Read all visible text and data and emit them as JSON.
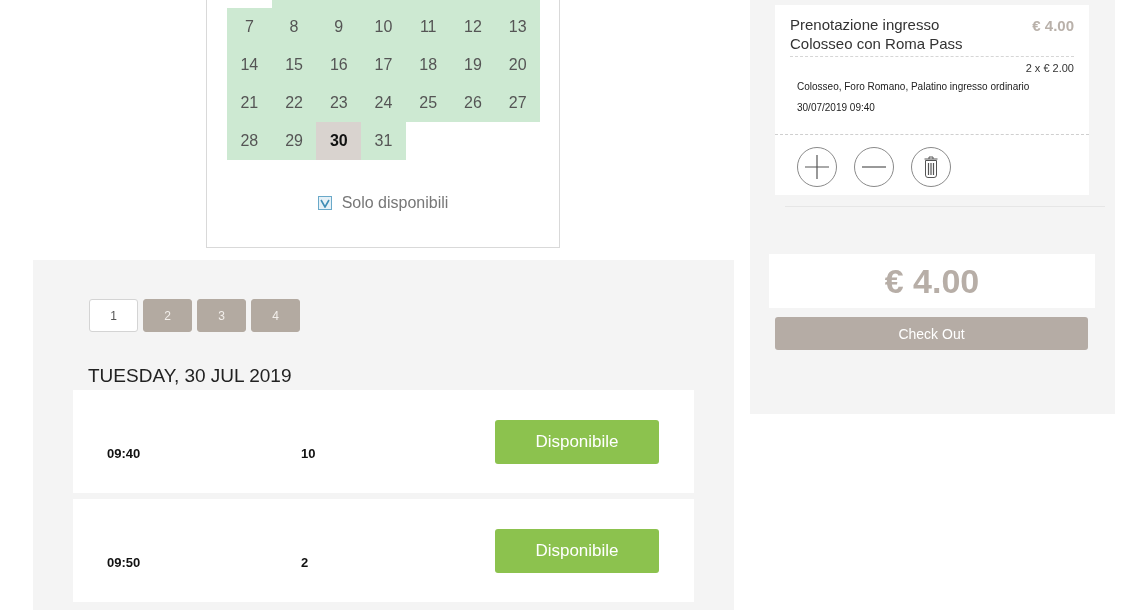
{
  "calendar": {
    "weeks": [
      {
        "days": [
          {
            "available": true,
            "selected": false
          },
          {
            "available": true,
            "selected": false
          },
          {
            "available": true,
            "selected": false
          },
          {
            "available": true,
            "selected": false
          },
          {
            "available": true,
            "selected": false
          },
          {
            "available": true,
            "selected": false
          }
        ]
      },
      {
        "days": [
          {
            "label": "7",
            "available": true,
            "selected": false
          },
          {
            "label": "8",
            "available": true,
            "selected": false
          },
          {
            "label": "9",
            "available": true,
            "selected": false
          },
          {
            "label": "10",
            "available": true,
            "selected": false
          },
          {
            "label": "11",
            "available": true,
            "selected": false
          },
          {
            "label": "12",
            "available": true,
            "selected": false
          },
          {
            "label": "13",
            "available": true,
            "selected": false
          }
        ]
      },
      {
        "days": [
          {
            "label": "14",
            "available": true,
            "selected": false
          },
          {
            "label": "15",
            "available": true,
            "selected": false
          },
          {
            "label": "16",
            "available": true,
            "selected": false
          },
          {
            "label": "17",
            "available": true,
            "selected": false
          },
          {
            "label": "18",
            "available": true,
            "selected": false
          },
          {
            "label": "19",
            "available": true,
            "selected": false
          },
          {
            "label": "20",
            "available": true,
            "selected": false
          }
        ]
      },
      {
        "days": [
          {
            "label": "21",
            "available": true,
            "selected": false
          },
          {
            "label": "22",
            "available": true,
            "selected": false
          },
          {
            "label": "23",
            "available": true,
            "selected": false
          },
          {
            "label": "24",
            "available": true,
            "selected": false
          },
          {
            "label": "25",
            "available": true,
            "selected": false
          },
          {
            "label": "26",
            "available": true,
            "selected": false
          },
          {
            "label": "27",
            "available": true,
            "selected": false
          }
        ]
      },
      {
        "days": [
          {
            "label": "28",
            "available": true,
            "selected": false
          },
          {
            "label": "29",
            "available": true,
            "selected": false
          },
          {
            "label": "30",
            "available": true,
            "selected": true
          },
          {
            "label": "31",
            "available": true,
            "selected": false
          }
        ]
      }
    ],
    "filter": {
      "label": "Solo disponibili",
      "checked": true
    }
  },
  "slots": {
    "pages": [
      {
        "label": "1",
        "selected": true
      },
      {
        "label": "2",
        "selected": false
      },
      {
        "label": "3",
        "selected": false
      },
      {
        "label": "4",
        "selected": false
      }
    ],
    "date_heading": "TUESDAY, 30 JUL 2019",
    "rows": [
      {
        "time": "09:40",
        "count": "10",
        "action": "Disponibile"
      },
      {
        "time": "09:50",
        "count": "2",
        "action": "Disponibile"
      }
    ]
  },
  "cart": {
    "items": [
      {
        "title": "Prenotazione ingresso Colosseo con Roma Pass",
        "price": "€ 4.00",
        "quantity_line": "2 x € 2.00",
        "description": "Colosseo, Foro Romano, Palatino ingresso ordinario",
        "datetime": "30/07/2019 09:40"
      }
    ],
    "total": "€ 4.00",
    "checkout_button": "Check Out"
  }
}
